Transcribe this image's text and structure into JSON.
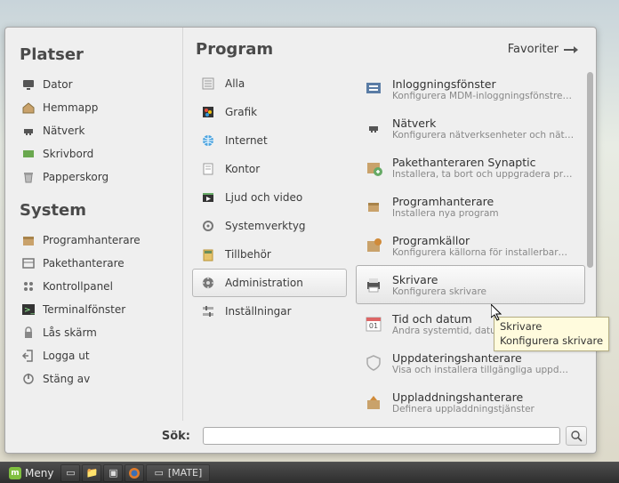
{
  "left": {
    "places_title": "Platser",
    "places": [
      {
        "icon": "monitor",
        "label": "Dator"
      },
      {
        "icon": "home",
        "label": "Hemmapp"
      },
      {
        "icon": "network",
        "label": "Nätverk"
      },
      {
        "icon": "desktop",
        "label": "Skrivbord"
      },
      {
        "icon": "trash",
        "label": "Papperskorg"
      }
    ],
    "system_title": "System",
    "system": [
      {
        "icon": "package",
        "label": "Programhanterare"
      },
      {
        "icon": "box",
        "label": "Pakethanterare"
      },
      {
        "icon": "control",
        "label": "Kontrollpanel"
      },
      {
        "icon": "terminal",
        "label": "Terminalfönster"
      },
      {
        "icon": "lock",
        "label": "Lås skärm"
      },
      {
        "icon": "logout",
        "label": "Logga ut"
      },
      {
        "icon": "power",
        "label": "Stäng av"
      }
    ]
  },
  "right": {
    "title": "Program",
    "favorites_label": "Favoriter",
    "categories": [
      {
        "icon": "all",
        "label": "Alla"
      },
      {
        "icon": "graphics",
        "label": "Grafik"
      },
      {
        "icon": "internet",
        "label": "Internet"
      },
      {
        "icon": "office",
        "label": "Kontor"
      },
      {
        "icon": "media",
        "label": "Ljud och video"
      },
      {
        "icon": "tools",
        "label": "Systemverktyg"
      },
      {
        "icon": "acc",
        "label": "Tillbehör"
      },
      {
        "icon": "admin",
        "label": "Administration",
        "selected": true
      },
      {
        "icon": "prefs",
        "label": "Inställningar"
      }
    ],
    "apps": [
      {
        "icon": "login",
        "name": "Inloggningsfönster",
        "desc": "Konfigurera MDM-inloggningsfönstre…"
      },
      {
        "icon": "network",
        "name": "Nätverk",
        "desc": "Konfigurera nätverksenheter och nät…"
      },
      {
        "icon": "synaptic",
        "name": "Pakethanteraren Synaptic",
        "desc": "Installera, ta bort och uppgradera pr…"
      },
      {
        "icon": "package",
        "name": "Programhanterare",
        "desc": "Installera nya program"
      },
      {
        "icon": "sources",
        "name": "Programkällor",
        "desc": "Konfigurera källorna för installerbar…"
      },
      {
        "icon": "printer",
        "name": "Skrivare",
        "desc": "Konfigurera skrivare",
        "selected": true
      },
      {
        "icon": "clock",
        "name": "Tid och datum",
        "desc": "Ändra systemtid, datum och tidszon."
      },
      {
        "icon": "shield",
        "name": "Uppdateringshanterare",
        "desc": "Visa och installera tillgängliga uppd…"
      },
      {
        "icon": "upload",
        "name": "Uppladdningshanterare",
        "desc": "Definera uppladdningstjänster"
      }
    ]
  },
  "tooltip": {
    "line1": "Skrivare",
    "line2": "Konfigurera skrivare"
  },
  "search": {
    "label": "Sök:",
    "value": ""
  },
  "taskbar": {
    "menu_label": "Meny",
    "task_label": "[MATE]"
  }
}
